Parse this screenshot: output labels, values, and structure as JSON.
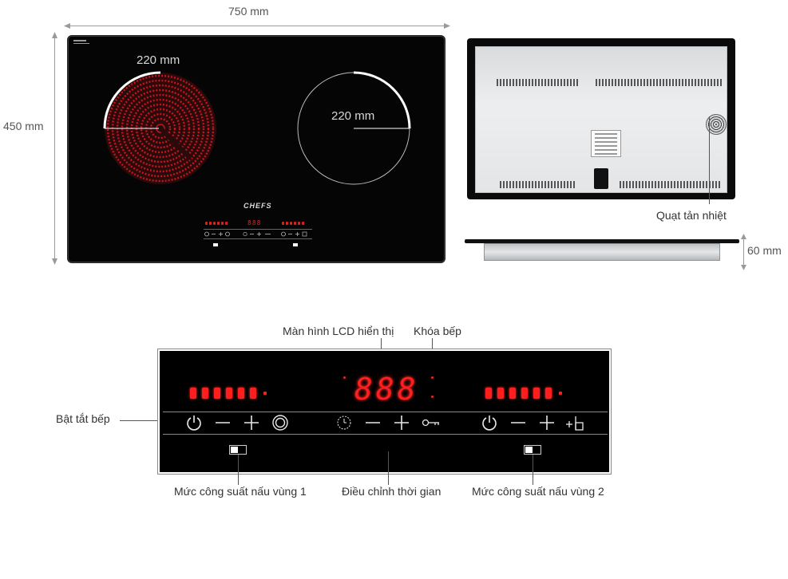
{
  "dimensions": {
    "width_label": "750 mm",
    "height_label": "450 mm",
    "depth_label": "60 mm"
  },
  "zones": {
    "left_label": "220 mm",
    "right_label": "220 mm"
  },
  "hob_text": {
    "logo": "CHEFS",
    "mini_lcd": "888"
  },
  "panel": {
    "lcd": "888"
  },
  "callouts": {
    "fan": "Quạt tản nhiệt",
    "lcd": "Màn hình LCD hiển thị",
    "lock": "Khóa bếp",
    "power": "Bật tắt bếp",
    "zone1": "Mức công suất nấu vùng 1",
    "timer": "Điều chỉnh thời gian",
    "zone2": "Mức công suất nấu vùng 2"
  },
  "icons": {
    "power": "power-icon",
    "minus": "minus-icon",
    "plus": "plus-icon",
    "zone_select": "zone-ring-icon",
    "timer": "clock-icon",
    "lock": "key-icon",
    "boost": "boost-icon"
  },
  "colors": {
    "led_red": "#ff1e1e",
    "glass_black": "#050505",
    "coil_red": "#c8141e"
  }
}
